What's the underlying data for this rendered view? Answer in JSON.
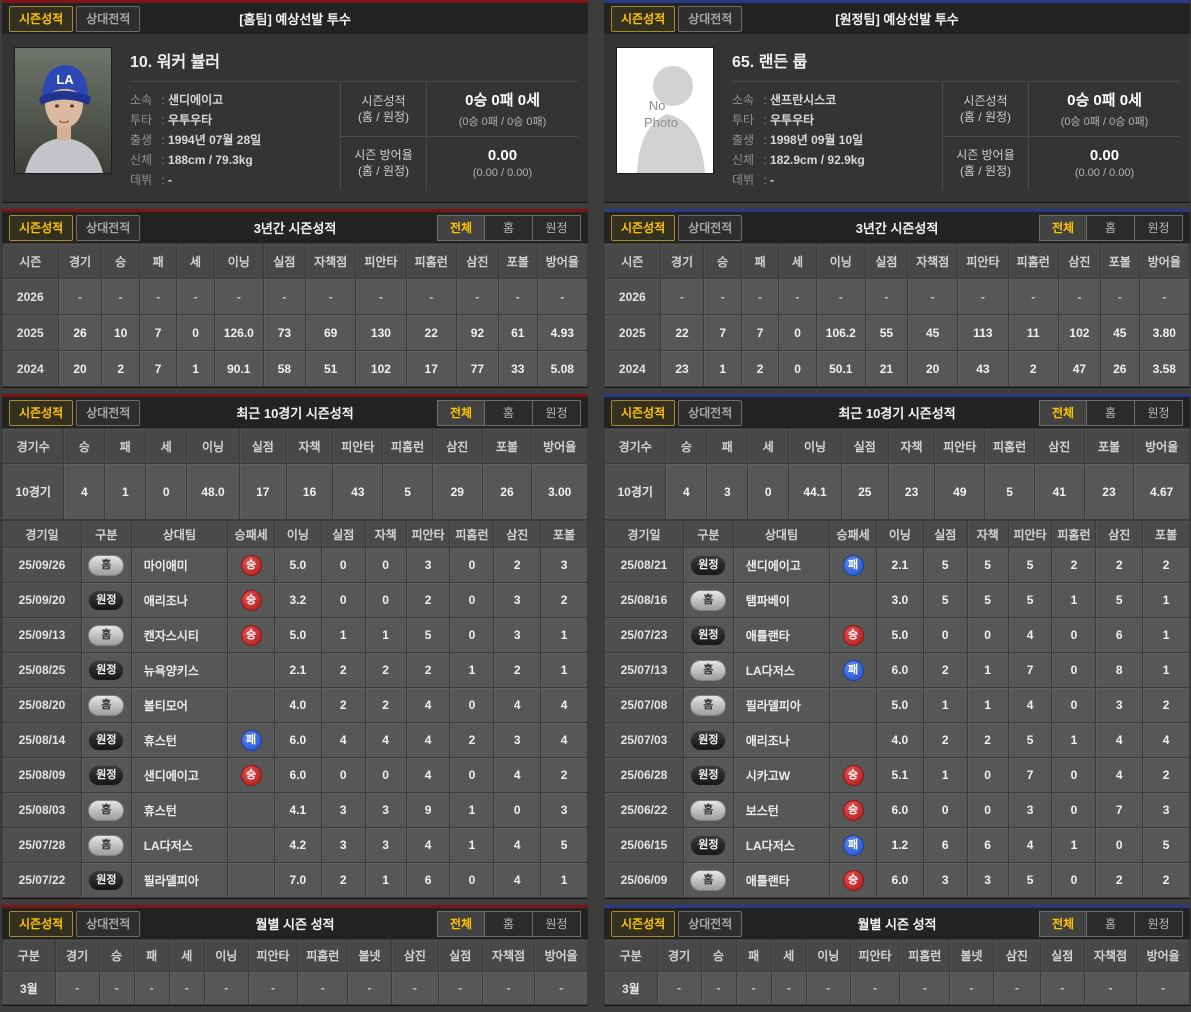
{
  "colors": {
    "home_accent": "#7e1416",
    "away_accent": "#263a86",
    "active_yellow": "#ffc400",
    "win_badge": "#b01c1c",
    "loss_badge": "#1f4ecf"
  },
  "panels": [
    {
      "side": "home",
      "tabs": [
        "시즌성적",
        "상대전적"
      ],
      "filters": [
        "전체",
        "홈",
        "원정"
      ],
      "player": {
        "header_title": "[홈팀] 예상선발 투수",
        "name": "10. 워커 뷸러",
        "photo": "real",
        "photo_text": "",
        "cap_text": "LA",
        "info": [
          {
            "label": "소속",
            "value": "샌디에이고"
          },
          {
            "label": "투타",
            "value": "우투우타"
          },
          {
            "label": "출생",
            "value": "1994년 07월 28일"
          },
          {
            "label": "신체",
            "value": "188cm / 79.3kg"
          },
          {
            "label": "데뷔",
            "value": "-"
          }
        ],
        "stats": [
          {
            "label": "시즌성적",
            "sublabel": "(홈 / 원정)",
            "value": "0승 0패 0세",
            "subvalue": "(0승 0패 / 0승 0패)"
          },
          {
            "label": "시즌 방어율",
            "sublabel": "(홈 / 원정)",
            "value": "0.00",
            "subvalue": "(0.00 / 0.00)"
          }
        ]
      },
      "three_year": {
        "title": "3년간 시즌성적",
        "columns": [
          "시즌",
          "경기",
          "승",
          "패",
          "세",
          "이닝",
          "실점",
          "자책점",
          "피안타",
          "피홈런",
          "삼진",
          "포볼",
          "방어율"
        ],
        "rows": [
          [
            "2026",
            "-",
            "-",
            "-",
            "-",
            "-",
            "-",
            "-",
            "-",
            "-",
            "-",
            "-",
            "-"
          ],
          [
            "2025",
            "26",
            "10",
            "7",
            "0",
            "126.0",
            "73",
            "69",
            "130",
            "22",
            "92",
            "61",
            "4.93"
          ],
          [
            "2024",
            "20",
            "2",
            "7",
            "1",
            "90.1",
            "58",
            "51",
            "102",
            "17",
            "77",
            "33",
            "5.08"
          ]
        ]
      },
      "recent": {
        "title": "최근 10경기 시즌성적",
        "summary_columns": [
          "경기수",
          "승",
          "패",
          "세",
          "이닝",
          "실점",
          "자책",
          "피안타",
          "피홈런",
          "삼진",
          "포볼",
          "방어율"
        ],
        "summary_row": [
          "10경기",
          "4",
          "1",
          "0",
          "48.0",
          "17",
          "16",
          "43",
          "5",
          "29",
          "26",
          "3.00"
        ],
        "game_columns": [
          "경기일",
          "구분",
          "상대팀",
          "승패세",
          "이닝",
          "실점",
          "자책",
          "피안타",
          "피홈런",
          "삼진",
          "포볼"
        ],
        "games": [
          {
            "date": "25/09/26",
            "venue": "홈",
            "opponent": "마이애미",
            "result": "승",
            "stats": [
              "5.0",
              "0",
              "0",
              "3",
              "0",
              "2",
              "3"
            ]
          },
          {
            "date": "25/09/20",
            "venue": "원정",
            "opponent": "애리조나",
            "result": "승",
            "stats": [
              "3.2",
              "0",
              "0",
              "2",
              "0",
              "3",
              "2"
            ]
          },
          {
            "date": "25/09/13",
            "venue": "홈",
            "opponent": "캔자스시티",
            "result": "승",
            "stats": [
              "5.0",
              "1",
              "1",
              "5",
              "0",
              "3",
              "1"
            ]
          },
          {
            "date": "25/08/25",
            "venue": "원정",
            "opponent": "뉴욕양키스",
            "result": "",
            "stats": [
              "2.1",
              "2",
              "2",
              "2",
              "1",
              "2",
              "1"
            ]
          },
          {
            "date": "25/08/20",
            "venue": "홈",
            "opponent": "볼티모어",
            "result": "",
            "stats": [
              "4.0",
              "2",
              "2",
              "4",
              "0",
              "4",
              "4"
            ]
          },
          {
            "date": "25/08/14",
            "venue": "원정",
            "opponent": "휴스턴",
            "result": "패",
            "stats": [
              "6.0",
              "4",
              "4",
              "4",
              "2",
              "3",
              "4"
            ]
          },
          {
            "date": "25/08/09",
            "venue": "원정",
            "opponent": "샌디에이고",
            "result": "승",
            "stats": [
              "6.0",
              "0",
              "0",
              "4",
              "0",
              "4",
              "2"
            ]
          },
          {
            "date": "25/08/03",
            "venue": "홈",
            "opponent": "휴스턴",
            "result": "",
            "stats": [
              "4.1",
              "3",
              "3",
              "9",
              "1",
              "0",
              "3"
            ]
          },
          {
            "date": "25/07/28",
            "venue": "홈",
            "opponent": "LA다저스",
            "result": "",
            "stats": [
              "4.2",
              "3",
              "3",
              "4",
              "1",
              "4",
              "5"
            ]
          },
          {
            "date": "25/07/22",
            "venue": "원정",
            "opponent": "필라델피아",
            "result": "",
            "stats": [
              "7.0",
              "2",
              "1",
              "6",
              "0",
              "4",
              "1"
            ]
          }
        ]
      },
      "monthly": {
        "title": "월별 시즌 성적",
        "columns": [
          "구분",
          "경기",
          "승",
          "패",
          "세",
          "이닝",
          "피안타",
          "피홈런",
          "볼넷",
          "삼진",
          "실점",
          "자책점",
          "방어율"
        ],
        "rows": [
          [
            "3월",
            "-",
            "-",
            "-",
            "-",
            "-",
            "-",
            "-",
            "-",
            "-",
            "-",
            "-",
            "-"
          ]
        ]
      }
    },
    {
      "side": "away",
      "tabs": [
        "시즌성적",
        "상대전적"
      ],
      "filters": [
        "전체",
        "홈",
        "원정"
      ],
      "player": {
        "header_title": "[원정팀] 예상선발 투수",
        "name": "65. 랜든 룹",
        "photo": "none",
        "photo_text": "No Photo",
        "cap_text": "",
        "info": [
          {
            "label": "소속",
            "value": "샌프란시스코"
          },
          {
            "label": "투타",
            "value": "우투우타"
          },
          {
            "label": "출생",
            "value": "1998년 09월 10일"
          },
          {
            "label": "신체",
            "value": "182.9cm / 92.9kg"
          },
          {
            "label": "데뷔",
            "value": "-"
          }
        ],
        "stats": [
          {
            "label": "시즌성적",
            "sublabel": "(홈 / 원정)",
            "value": "0승 0패 0세",
            "subvalue": "(0승 0패 / 0승 0패)"
          },
          {
            "label": "시즌 방어율",
            "sublabel": "(홈 / 원정)",
            "value": "0.00",
            "subvalue": "(0.00 / 0.00)"
          }
        ]
      },
      "three_year": {
        "title": "3년간 시즌성적",
        "columns": [
          "시즌",
          "경기",
          "승",
          "패",
          "세",
          "이닝",
          "실점",
          "자책점",
          "피안타",
          "피홈런",
          "삼진",
          "포볼",
          "방어율"
        ],
        "rows": [
          [
            "2026",
            "-",
            "-",
            "-",
            "-",
            "-",
            "-",
            "-",
            "-",
            "-",
            "-",
            "-",
            "-"
          ],
          [
            "2025",
            "22",
            "7",
            "7",
            "0",
            "106.2",
            "55",
            "45",
            "113",
            "11",
            "102",
            "45",
            "3.80"
          ],
          [
            "2024",
            "23",
            "1",
            "2",
            "0",
            "50.1",
            "21",
            "20",
            "43",
            "2",
            "47",
            "26",
            "3.58"
          ]
        ]
      },
      "recent": {
        "title": "최근 10경기 시즌성적",
        "summary_columns": [
          "경기수",
          "승",
          "패",
          "세",
          "이닝",
          "실점",
          "자책",
          "피안타",
          "피홈런",
          "삼진",
          "포볼",
          "방어율"
        ],
        "summary_row": [
          "10경기",
          "4",
          "3",
          "0",
          "44.1",
          "25",
          "23",
          "49",
          "5",
          "41",
          "23",
          "4.67"
        ],
        "game_columns": [
          "경기일",
          "구분",
          "상대팀",
          "승패세",
          "이닝",
          "실점",
          "자책",
          "피안타",
          "피홈런",
          "삼진",
          "포볼"
        ],
        "games": [
          {
            "date": "25/08/21",
            "venue": "원정",
            "opponent": "샌디에이고",
            "result": "패",
            "stats": [
              "2.1",
              "5",
              "5",
              "5",
              "2",
              "2",
              "2"
            ]
          },
          {
            "date": "25/08/16",
            "venue": "홈",
            "opponent": "탬파베이",
            "result": "",
            "stats": [
              "3.0",
              "5",
              "5",
              "5",
              "1",
              "5",
              "1"
            ]
          },
          {
            "date": "25/07/23",
            "venue": "원정",
            "opponent": "애틀랜타",
            "result": "승",
            "stats": [
              "5.0",
              "0",
              "0",
              "4",
              "0",
              "6",
              "1"
            ]
          },
          {
            "date": "25/07/13",
            "venue": "홈",
            "opponent": "LA다저스",
            "result": "패",
            "stats": [
              "6.0",
              "2",
              "1",
              "7",
              "0",
              "8",
              "1"
            ]
          },
          {
            "date": "25/07/08",
            "venue": "홈",
            "opponent": "필라델피아",
            "result": "",
            "stats": [
              "5.0",
              "1",
              "1",
              "4",
              "0",
              "3",
              "2"
            ]
          },
          {
            "date": "25/07/03",
            "venue": "원정",
            "opponent": "애리조나",
            "result": "",
            "stats": [
              "4.0",
              "2",
              "2",
              "5",
              "1",
              "4",
              "4"
            ]
          },
          {
            "date": "25/06/28",
            "venue": "원정",
            "opponent": "시카고W",
            "result": "승",
            "stats": [
              "5.1",
              "1",
              "0",
              "7",
              "0",
              "4",
              "2"
            ]
          },
          {
            "date": "25/06/22",
            "venue": "홈",
            "opponent": "보스턴",
            "result": "승",
            "stats": [
              "6.0",
              "0",
              "0",
              "3",
              "0",
              "7",
              "3"
            ]
          },
          {
            "date": "25/06/15",
            "venue": "원정",
            "opponent": "LA다저스",
            "result": "패",
            "stats": [
              "1.2",
              "6",
              "6",
              "4",
              "1",
              "0",
              "5"
            ]
          },
          {
            "date": "25/06/09",
            "venue": "홈",
            "opponent": "애틀랜타",
            "result": "승",
            "stats": [
              "6.0",
              "3",
              "3",
              "5",
              "0",
              "2",
              "2"
            ]
          }
        ]
      },
      "monthly": {
        "title": "월별 시즌 성적",
        "columns": [
          "구분",
          "경기",
          "승",
          "패",
          "세",
          "이닝",
          "피안타",
          "피홈런",
          "볼넷",
          "삼진",
          "실점",
          "자책점",
          "방어율"
        ],
        "rows": [
          [
            "3월",
            "-",
            "-",
            "-",
            "-",
            "-",
            "-",
            "-",
            "-",
            "-",
            "-",
            "-",
            "-"
          ]
        ]
      }
    }
  ]
}
